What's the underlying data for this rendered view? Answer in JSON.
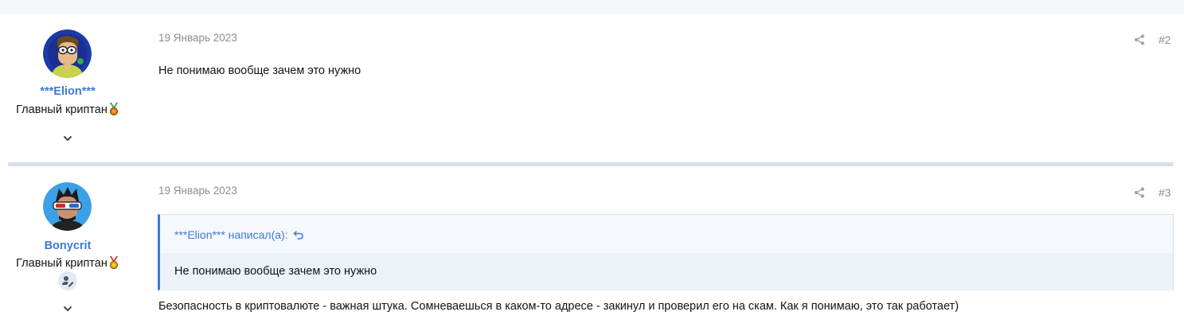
{
  "posts": [
    {
      "username": "***Elion***",
      "user_title": "Главный криптан",
      "date": "19 Январь 2023",
      "post_number": "#2",
      "content": "Не понимаю вообще зачем это нужно"
    },
    {
      "username": "Bonycrit",
      "user_title": "Главный криптан",
      "date": "19 Январь 2023",
      "post_number": "#3",
      "quote_author": "***Elion*** написал(а):",
      "quote_text": "Не понимаю вообще зачем это нужно",
      "content": "Безопасность в криптовалюте - важная штука. Сомневаешься в каком-то адресе - закинул и проверил его на скам. Как я понимаю, это так работает)"
    }
  ],
  "icons": {
    "share": "share-icon",
    "expand": "chevron-down-icon",
    "medal": "medal-icon",
    "quote_jump": "reply-arrow-icon",
    "badge": "user-edit-icon"
  },
  "colors": {
    "accent": "#3a7ad6",
    "muted_text": "#8c8c8c",
    "separator": "#d4dfef",
    "quote_bg": "#f5f8fc"
  }
}
